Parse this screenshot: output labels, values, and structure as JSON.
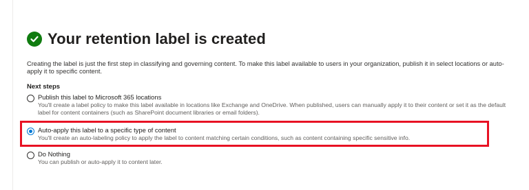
{
  "header": {
    "title": "Your retention label is created",
    "icon": "check-circle-icon",
    "icon_color": "#107c10"
  },
  "intro_text": "Creating the label is just the first step in classifying and governing content. To make this label available to users in your organization, publish it in select locations or auto-apply it to specific content.",
  "next_steps": {
    "heading": "Next steps",
    "options": [
      {
        "label": "Publish this label to Microsoft 365 locations",
        "description": "You'll create a label policy to make this label available in locations like Exchange and OneDrive. When published, users can manually apply it to their content or set it as the default label for content containers (such as SharePoint document libraries or email folders).",
        "selected": false
      },
      {
        "label": "Auto-apply this label to a specific type of content",
        "description": "You'll create an auto-labeling policy to apply the label to content matching certain conditions, such as content containing specific sensitive info.",
        "selected": true
      },
      {
        "label": "Do Nothing",
        "description": "You can publish or auto-apply it to content later.",
        "selected": false
      }
    ]
  },
  "colors": {
    "accent": "#0078d4",
    "highlight": "#e81123"
  }
}
